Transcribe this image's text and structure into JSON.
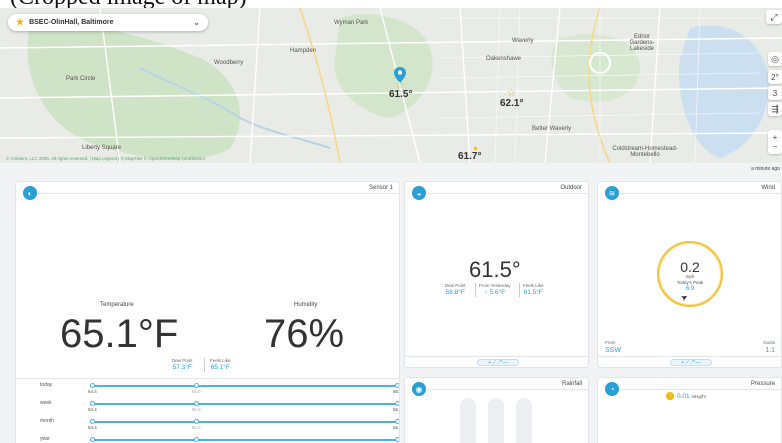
{
  "caption": "(Cropped image of map)",
  "map": {
    "station": "BSEC-OlinHall, Baltimore",
    "attribution": "© Ambient, LLC 2025. All rights reserved. | Map Legend | © MapTiler © OpenStreetMap contributors",
    "places": [
      {
        "name": "Wyman Park"
      },
      {
        "name": "Hampden"
      },
      {
        "name": "Woodberry"
      },
      {
        "name": "Park Circle"
      },
      {
        "name": "Liberty Square"
      },
      {
        "name": "Waverly"
      },
      {
        "name": "Ednor Gardens-Lakeside"
      },
      {
        "name": "Oakenshawe"
      },
      {
        "name": "Better Waverly"
      },
      {
        "name": "Coldstream-Homestead-Montebello"
      }
    ],
    "pins": [
      {
        "value": "61.5°"
      },
      {
        "value": "62.1°"
      },
      {
        "value": "61.7°"
      }
    ],
    "right_controls": [
      "2°",
      "3"
    ]
  },
  "updated": "a minute ago",
  "sensor1": {
    "title": "Sensor 1",
    "temperature_label": "Temperature",
    "temperature": "65.1°F",
    "humidity_label": "Humidity",
    "humidity": "76%",
    "dew_point_label": "Dew Point",
    "dew_point": "57.3°F",
    "feels_like_label": "Feels Like",
    "feels_like": "65.1°F",
    "ranges": [
      {
        "label": "today",
        "low": "64.4",
        "mid": "65.0",
        "high": "65.5",
        "knob_pos": [
          0.0,
          0.34,
          1.0
        ]
      },
      {
        "label": "week",
        "low": "64.4",
        "mid": "65.0",
        "high": "65.5",
        "knob_pos": [
          0.0,
          0.34,
          1.0
        ]
      },
      {
        "label": "month",
        "low": "64.4",
        "mid": "65.0",
        "high": "65.5",
        "knob_pos": [
          0.0,
          0.34,
          1.0
        ]
      },
      {
        "label": "year",
        "low": "64.4",
        "mid": "65.0",
        "high": "65.5",
        "knob_pos": [
          0.0,
          0.34,
          1.0
        ]
      }
    ]
  },
  "outdoor": {
    "title": "Outdoor",
    "temperature": "61.5°",
    "dew_point_label": "Dew Point",
    "dew_point": "58.8°F",
    "from_yesterday_label": "From Yesterday",
    "from_yesterday": "↑ 5.6°F",
    "feels_like_label": "Feels Like",
    "feels_like": "61.5°F",
    "chip": "+ ⟋ ↗ —"
  },
  "wind": {
    "title": "Wind",
    "speed": "0.2",
    "unit": "mph",
    "peak_label": "Today's Peak",
    "peak": "6.9",
    "from_label": "From",
    "from": "SSW",
    "gusts_label": "Gusts",
    "gusts": "1.1",
    "chip": "+ ⟋ ↗ —"
  },
  "rainfall": {
    "title": "Rainfall"
  },
  "pressure": {
    "title": "Pressure",
    "value": "0.01",
    "unit": "inHg/hr"
  },
  "colors": {
    "accent": "#2a9fd6",
    "gold": "#f2b705",
    "card_border": "#e2e4e8",
    "background": "#f2f3f5"
  }
}
